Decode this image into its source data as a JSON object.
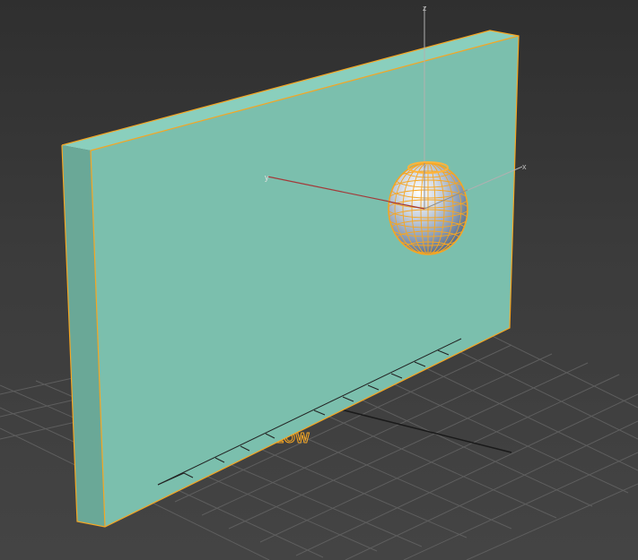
{
  "viewport": {
    "text_object_label": "FLOW",
    "axis_labels": {
      "x": "x",
      "y": "y",
      "z": "z"
    }
  },
  "colors": {
    "background": "#3d3d3d",
    "grid": "#5a5a5a",
    "panel_front": "#7bbfad",
    "panel_side": "#6aa897",
    "panel_top": "#8acfbd",
    "selection": "#f5a623",
    "axis_x": "#b0b0b0",
    "axis_y": "#a33a3a",
    "axis_z": "#b0b0b0"
  }
}
